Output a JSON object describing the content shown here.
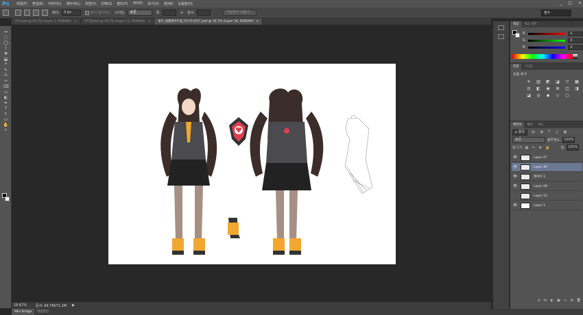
{
  "app": {
    "logo": "Ps"
  },
  "menubar": {
    "items": [
      "파일(F)",
      "편집(E)",
      "이미지(I)",
      "레이어(L)",
      "유형(Y)",
      "선택(S)",
      "필터(T)",
      "3D(D)",
      "보기(V)",
      "창(W)",
      "도움말(H)"
    ],
    "controls": [
      "_",
      "□",
      "×"
    ]
  },
  "options": {
    "feather_label": "페더:",
    "feather_value": "0 px",
    "antialias_label": "앤티 앨리어스",
    "style_label": "스타일:",
    "style_value": "표준",
    "width_label": "폭:",
    "height_label": "높이:",
    "refine_button": "가장자리 다듬기...",
    "workspace": "필수"
  },
  "tabs": [
    {
      "name": "카오.psd @ 16.7% (Layer 1, RGB/8#)",
      "close": "×",
      "active": false
    },
    {
      "name": "미드컬.psd @ 16.7% (Layer 11, RGB/8#)",
      "close": "×",
      "active": false
    },
    {
      "name": "빌즈_클롤레이트형_미스트사이드.psd @ 16.7% (Layer 30, RGB/8#)",
      "close": "×",
      "active": true
    }
  ],
  "tools": [
    "↔",
    "⬚",
    "◯",
    "⌇",
    "✥",
    "⬓",
    "⌿",
    "✎",
    "⎌",
    "✑",
    "⌫",
    "▭",
    "◐",
    "✒",
    "T",
    "↖",
    "▭",
    "✋",
    "⌕"
  ],
  "status": {
    "zoom": "16.67%",
    "doc": "문서: 64.7M/71.2M"
  },
  "bottom_tabs": [
    {
      "label": "Mini Bridge",
      "active": true
    },
    {
      "label": "타임라인",
      "active": false
    }
  ],
  "color_panel": {
    "tabs": [
      {
        "label": "색상",
        "active": true
      },
      {
        "label": "색상 견본",
        "active": false
      }
    ],
    "channels": [
      {
        "label": "R",
        "value": "0",
        "gradient": "linear-gradient(to right,#000,#f00)"
      },
      {
        "label": "G",
        "value": "0",
        "gradient": "linear-gradient(to right,#000,#0f0)"
      },
      {
        "label": "B",
        "value": "0",
        "gradient": "linear-gradient(to right,#000,#00f)"
      }
    ]
  },
  "adjust_panel": {
    "tabs": [
      {
        "label": "조정",
        "active": true
      },
      {
        "label": "스타일",
        "active": false
      }
    ],
    "title": "조정 추가",
    "icons": [
      "☀",
      "▥",
      "◩",
      "◪",
      "▽",
      "▦",
      "⚖",
      "◧",
      "◉",
      "⊞",
      "◫",
      "◨",
      "◪",
      "◎",
      "◆",
      "◇",
      "▢"
    ]
  },
  "layers_panel": {
    "tabs": [
      {
        "label": "레이어",
        "active": true
      },
      {
        "label": "채널",
        "active": false
      },
      {
        "label": "패스",
        "active": false
      }
    ],
    "filter": "ρ 종류",
    "blend_mode": "표준",
    "opacity_label": "불투명도:",
    "opacity": "100%",
    "lock_label": "잠그기:",
    "fill_label": "칠:",
    "fill": "100%",
    "layers": [
      {
        "name": "Layer 27",
        "visible": true,
        "selected": false
      },
      {
        "name": "Layer 30",
        "visible": true,
        "selected": true
      },
      {
        "name": "레이어 3",
        "visible": true,
        "selected": false
      },
      {
        "name": "Layer 29",
        "visible": true,
        "selected": false
      },
      {
        "name": "Layer 13",
        "visible": false,
        "selected": false
      },
      {
        "name": "Layer 1",
        "visible": true,
        "selected": false
      }
    ],
    "footer_icons": [
      "⊝",
      "fx",
      "◐",
      "▣",
      "▭",
      "⊞",
      "🗑"
    ]
  }
}
